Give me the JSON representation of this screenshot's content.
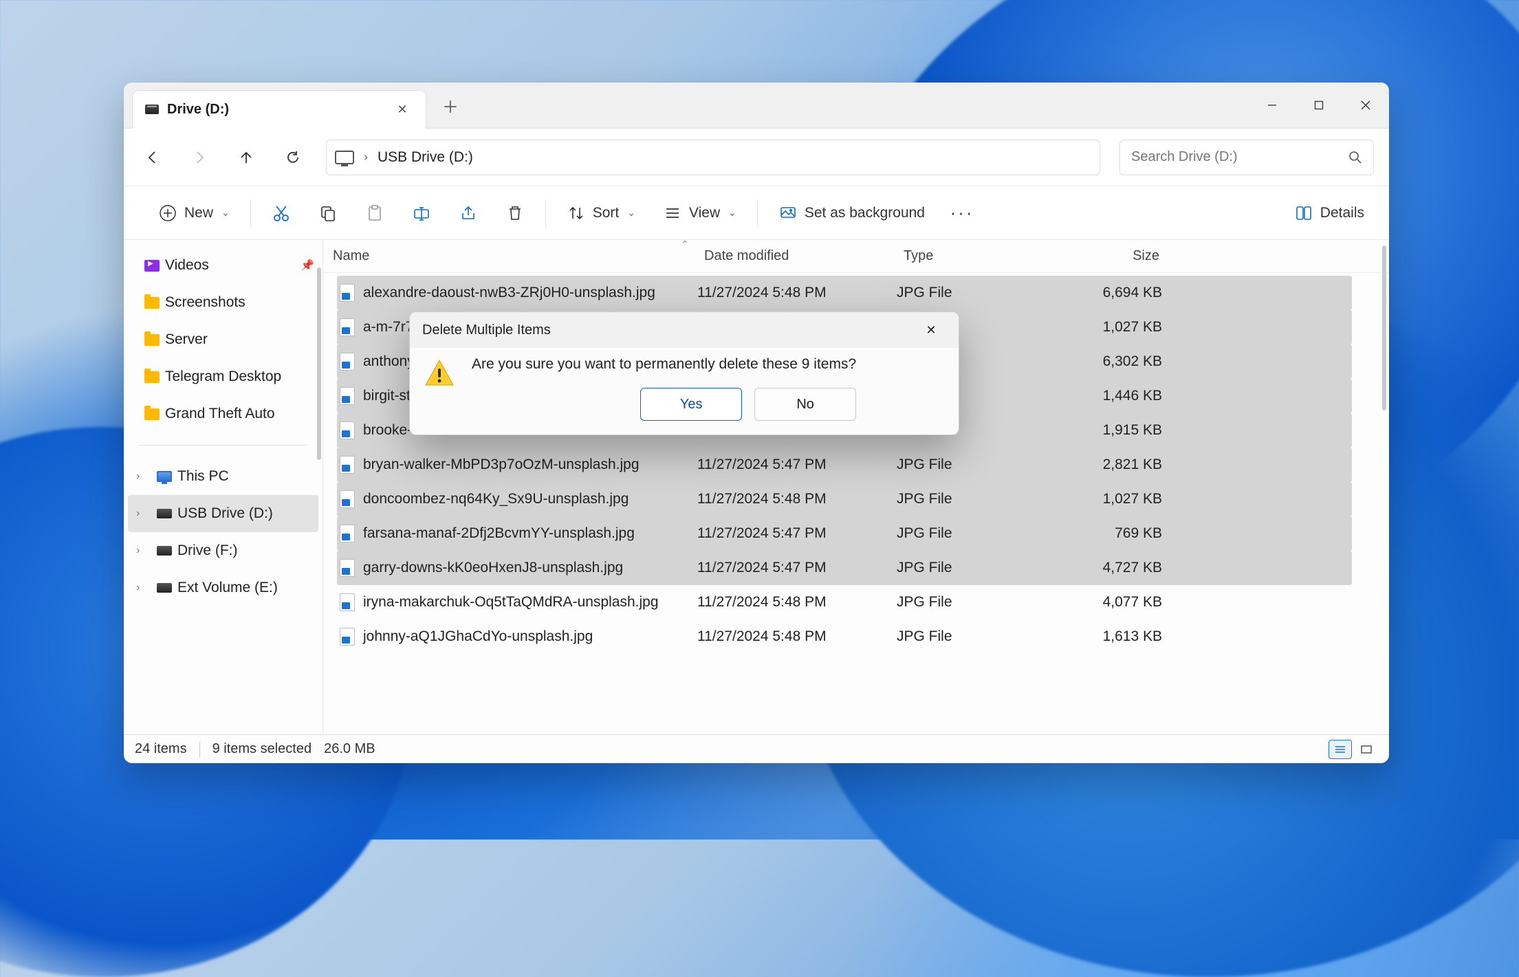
{
  "tab": {
    "title": "Drive (D:)"
  },
  "address": {
    "location": "USB Drive (D:)"
  },
  "search": {
    "placeholder": "Search Drive (D:)"
  },
  "toolbar": {
    "new_label": "New",
    "sort_label": "Sort",
    "view_label": "View",
    "background_label": "Set as background",
    "details_label": "Details"
  },
  "sidebar": {
    "quick": [
      {
        "label": "Videos",
        "icon": "videos",
        "pinned": true
      },
      {
        "label": "Screenshots",
        "icon": "folder"
      },
      {
        "label": "Server",
        "icon": "folder"
      },
      {
        "label": "Telegram Desktop",
        "icon": "folder"
      },
      {
        "label": "Grand Theft Auto",
        "icon": "folder"
      }
    ],
    "tree": [
      {
        "label": "This PC",
        "icon": "pc",
        "selected": false
      },
      {
        "label": "USB Drive (D:)",
        "icon": "drive",
        "selected": true
      },
      {
        "label": "Drive (F:)",
        "icon": "drive",
        "selected": false
      },
      {
        "label": "Ext Volume (E:)",
        "icon": "drive",
        "selected": false
      }
    ]
  },
  "columns": {
    "name": "Name",
    "date": "Date modified",
    "type": "Type",
    "size": "Size"
  },
  "files": [
    {
      "name": "alexandre-daoust-nwB3-ZRj0H0-unsplash.jpg",
      "date": "11/27/2024 5:48 PM",
      "type": "JPG File",
      "size": "6,694 KB",
      "selected": true
    },
    {
      "name": "a-m-7r7",
      "date": "",
      "type": "",
      "size": "1,027 KB",
      "selected": true
    },
    {
      "name": "anthony",
      "date": "",
      "type": "",
      "size": "6,302 KB",
      "selected": true
    },
    {
      "name": "birgit-st",
      "date": "",
      "type": "",
      "size": "1,446 KB",
      "selected": true
    },
    {
      "name": "brooke-",
      "date": "",
      "type": "",
      "size": "1,915 KB",
      "selected": true
    },
    {
      "name": "bryan-walker-MbPD3p7oOzM-unsplash.jpg",
      "date": "11/27/2024 5:47 PM",
      "type": "JPG File",
      "size": "2,821 KB",
      "selected": true
    },
    {
      "name": "doncoombez-nq64Ky_Sx9U-unsplash.jpg",
      "date": "11/27/2024 5:48 PM",
      "type": "JPG File",
      "size": "1,027 KB",
      "selected": true
    },
    {
      "name": "farsana-manaf-2Dfj2BcvmYY-unsplash.jpg",
      "date": "11/27/2024 5:47 PM",
      "type": "JPG File",
      "size": "769 KB",
      "selected": true
    },
    {
      "name": "garry-downs-kK0eoHxenJ8-unsplash.jpg",
      "date": "11/27/2024 5:47 PM",
      "type": "JPG File",
      "size": "4,727 KB",
      "selected": true
    },
    {
      "name": "iryna-makarchuk-Oq5tTaQMdRA-unsplash.jpg",
      "date": "11/27/2024 5:48 PM",
      "type": "JPG File",
      "size": "4,077 KB",
      "selected": false
    },
    {
      "name": "johnny-aQ1JGhaCdYo-unsplash.jpg",
      "date": "11/27/2024 5:48 PM",
      "type": "JPG File",
      "size": "1,613 KB",
      "selected": false
    }
  ],
  "status": {
    "total": "24 items",
    "selected": "9 items selected",
    "size": "26.0 MB"
  },
  "dialog": {
    "title": "Delete Multiple Items",
    "message": "Are you sure you want to permanently delete these 9 items?",
    "yes": "Yes",
    "no": "No"
  }
}
